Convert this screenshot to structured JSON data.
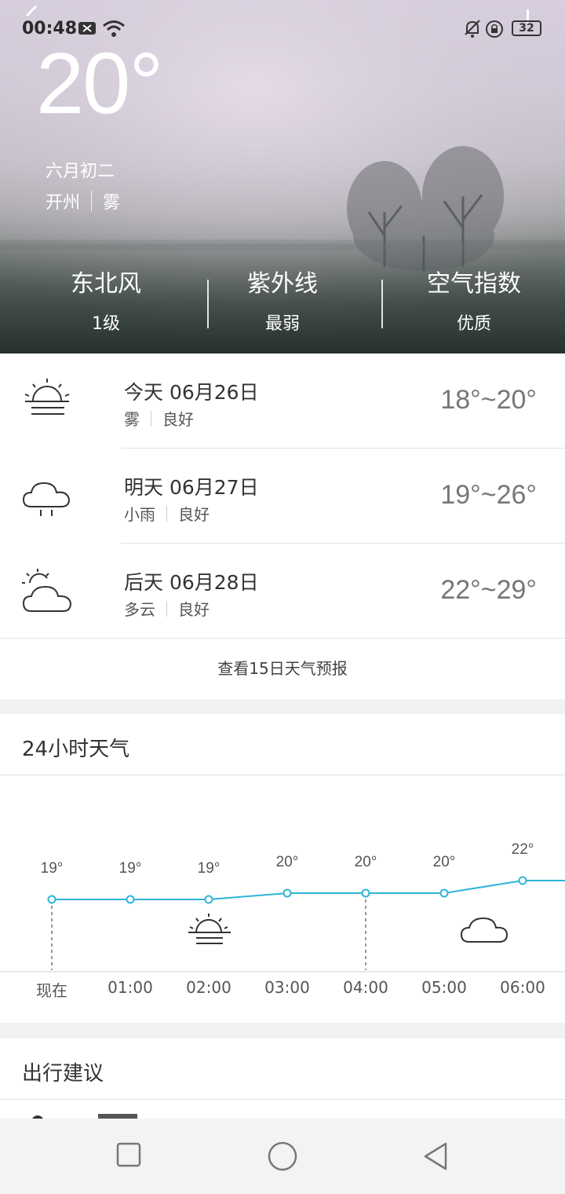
{
  "status_bar": {
    "time": "00:48",
    "battery": "32"
  },
  "current": {
    "temperature": "20°",
    "lunar_date": "六月初二",
    "city": "开州",
    "condition": "雾"
  },
  "stats": [
    {
      "label": "东北风",
      "value": "1级"
    },
    {
      "label": "紫外线",
      "value": "最弱"
    },
    {
      "label": "空气指数",
      "value": "优质"
    }
  ],
  "forecast": [
    {
      "day": "今天 06月26日",
      "condition": "雾",
      "air": "良好",
      "temp": "18°~20°",
      "icon": "fog-icon"
    },
    {
      "day": "明天 06月27日",
      "condition": "小雨",
      "air": "良好",
      "temp": "19°~26°",
      "icon": "light-rain-icon"
    },
    {
      "day": "后天 06月28日",
      "condition": "多云",
      "air": "良好",
      "temp": "22°~29°",
      "icon": "partly-cloudy-icon"
    }
  ],
  "forecast_more": "查看15日天气预报",
  "hourly": {
    "title": "24小时天气",
    "times": [
      "现在",
      "01:00",
      "02:00",
      "03:00",
      "04:00",
      "05:00",
      "06:00"
    ],
    "temps": [
      19,
      19,
      19,
      20,
      20,
      20,
      22
    ],
    "temp_labels": [
      "19°",
      "19°",
      "19°",
      "20°",
      "20°",
      "20°",
      "22°"
    ],
    "icons": [
      "fog-icon",
      "cloudy-icon"
    ],
    "line_color": "#2fb4d8"
  },
  "travel": {
    "title": "出行建议"
  },
  "colors": {
    "accent_line": "#2fb4d8",
    "nav_bg": "#f3f3f3"
  }
}
